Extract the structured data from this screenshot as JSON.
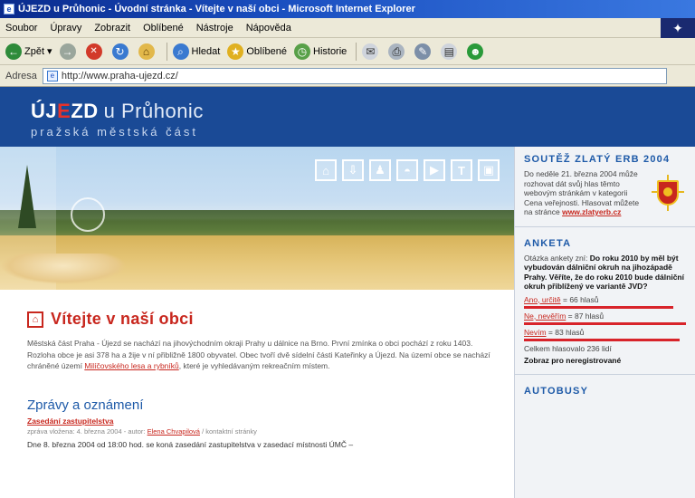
{
  "window": {
    "title": "ÚJEZD u Průhonic - Úvodní stránka - Vítejte v naší obci - Microsoft Internet Explorer"
  },
  "menu": [
    "Soubor",
    "Úpravy",
    "Zobrazit",
    "Oblíbené",
    "Nástroje",
    "Nápověda"
  ],
  "toolbar": {
    "back_label": "Zpět",
    "search_label": "Hledat",
    "favorites_label": "Oblíbené",
    "history_label": "Historie"
  },
  "address": {
    "label": "Adresa",
    "url": "http://www.praha-ujezd.cz/"
  },
  "site": {
    "brand_pre": "ÚJ",
    "brand_accent": "E",
    "brand_post": "ZD",
    "brand_town": "u Průhonic",
    "brand_sub": "pražská městská část",
    "accent_color": "#c8271e",
    "brand_blue": "#1a4a96"
  },
  "nav_icons": [
    {
      "name": "home-icon",
      "glyph": "⌂"
    },
    {
      "name": "download-icon",
      "glyph": "⇩"
    },
    {
      "name": "person-icon",
      "glyph": "♟"
    },
    {
      "name": "shield-icon",
      "glyph": "◓"
    },
    {
      "name": "play-icon",
      "glyph": "▶"
    },
    {
      "name": "text-icon",
      "glyph": "T"
    },
    {
      "name": "window-icon",
      "glyph": "▣"
    }
  ],
  "sidebar": {
    "contest": {
      "title": "SOUTĚŽ ZLATÝ ERB 2004",
      "text": "Do neděle 21. března 2004 může rozhovat dát svůj hlas těmto webovým stránkám v kategorii Cena veřejnosti. Hlasovat můžete na stránce",
      "link": "www.zlatyerb.cz"
    },
    "poll": {
      "title": "ANKETA",
      "intro": "Otázka ankety zní:",
      "question": "Do roku 2010 by měl být vybudován dálniční okruh na jihozápadě Prahy. Věříte, že do roku 2010 bude dálniční okruh přiblížený ve variantě JVD?",
      "options": [
        {
          "label": "Ano, určitě",
          "votes": "66 hlasů",
          "share": 0.92
        },
        {
          "label": "Ne, nevěřím",
          "votes": "87 hlasů",
          "share": 1.0
        },
        {
          "label": "Nevím",
          "votes": "83 hlasů",
          "share": 0.96
        }
      ],
      "total": "Celkem hlasovalo 236 lidí",
      "results_link": "Zobraz pro neregistrované"
    },
    "buses": {
      "title": "AUTOBUSY"
    }
  },
  "main": {
    "welcome_title": "Vítejte v naší obci",
    "intro_text": "Městská část Praha - Újezd se nachází na jihovýchodním okraji Prahy u dálnice na Brno. První zmínka o obci pochází z roku 1403. Rozloha obce je asi 378 ha a žije v ní přibližně 1800 obyvatel. Obec tvoří dvě sídelní části Kateřinky a Újezd. Na území obce se nachází chráněné území",
    "intro_link": "Milíčovského lesa a rybníků",
    "intro_tail": ", které je vyhledávaným rekreačním místem.",
    "news_title": "Zprávy a oznámení",
    "news_item_title": "Zasedání zastupitelstva",
    "news_meta_pre": "zpráva vložena: 4. března 2004 - autor:",
    "news_meta_author": "Elena Chvapilová",
    "news_meta_post": "/ kontaktní stránky",
    "news_body": "Dne 8. března 2004 od 18:00 hod. se koná zasedání zastupitelstva v zasedací místnosti ÚMČ –"
  }
}
